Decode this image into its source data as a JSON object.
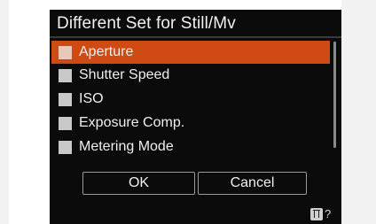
{
  "menu": {
    "title": "Different Set for Still/Mv",
    "items": [
      {
        "label": "Aperture",
        "selected": true
      },
      {
        "label": "Shutter Speed",
        "selected": false
      },
      {
        "label": "ISO",
        "selected": false
      },
      {
        "label": "Exposure Comp.",
        "selected": false
      },
      {
        "label": "Metering Mode",
        "selected": false
      }
    ]
  },
  "buttons": {
    "ok_label": "OK",
    "cancel_label": "Cancel"
  },
  "footer": {
    "help_icon": "trash-help-icon",
    "help_text": "?"
  },
  "colors": {
    "highlight": "#d04a14",
    "background": "#0b0b0b",
    "text": "#f0f0f0"
  }
}
